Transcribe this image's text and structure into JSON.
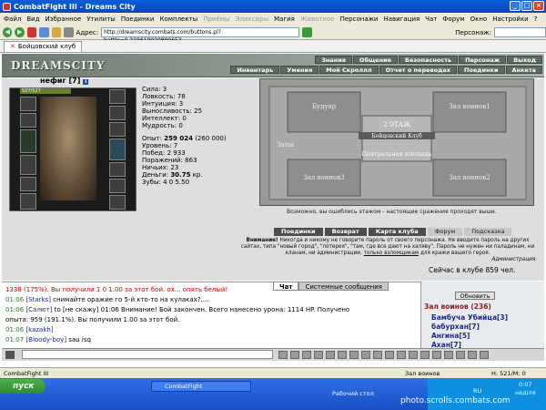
{
  "window": {
    "title": "CombatFight III - Dreams City"
  },
  "menu": [
    "Файл",
    "Вид",
    "Избранное",
    "Утилиты",
    "Поединки",
    "Комплекты",
    "Приёмы",
    "Эликсиры",
    "Магия",
    "Животное",
    "Персонажи",
    "Навигация",
    "Чат",
    "Форум",
    "Окно",
    "Настройки",
    "?"
  ],
  "menu_disabled": [
    "Приёмы",
    "Эликсиры",
    "Животное"
  ],
  "address": {
    "label": "Адрес:",
    "url": "http://dreamscity.combats.com/buttons.pl?battle=0.319619920890652",
    "person_label": "Персонаж:"
  },
  "tabs": [
    {
      "label": "Бойцовский клуб"
    }
  ],
  "banner": {
    "logo": "DREAMSCITY",
    "top": [
      "Знания",
      "Общение",
      "Безопасность",
      "Персонаж",
      "Выход"
    ],
    "bottom": [
      "Инвентарь",
      "Умения",
      "Мой Скроллл",
      "Отчет о переводах",
      "Поединки",
      "Анкета"
    ]
  },
  "character": {
    "name": "нефиг",
    "level": "[7]",
    "hp": "527/527",
    "stats": [
      {
        "label": "Сила:",
        "value": "3"
      },
      {
        "label": "Ловкость:",
        "value": "78"
      },
      {
        "label": "Интуиция:",
        "value": "3"
      },
      {
        "label": "Выносливость:",
        "value": "25"
      },
      {
        "label": "Интеллект:",
        "value": "0"
      },
      {
        "label": "Мудрость:",
        "value": "0"
      }
    ],
    "exp_label": "Опыт:",
    "exp": "259 024",
    "exp_next": "(260 000)",
    "level_label": "Уровень:",
    "level_val": "7",
    "wins_label": "Побед:",
    "wins": "2 933",
    "losses_label": "Поражений:",
    "losses": "863",
    "draws_label": "Ничьих:",
    "draws": "23",
    "money_label": "Деньги:",
    "money": "30.75",
    "money_unit": "кр.",
    "teeth_label": "Зубы:",
    "teeth": "4  0  5.50"
  },
  "map": {
    "rooms": [
      "Будуар",
      "Зал воинов1",
      "2 ЭТАЖ",
      "Бойцовский Клуб",
      "Залы",
      "Центральная площадь",
      "Зал воинов3",
      "Зал воинов2"
    ],
    "note": "Возможно, вы ошиблись этажом - настоящие сражения проходят выше."
  },
  "club_buttons": [
    {
      "label": "Поединки",
      "dark": true
    },
    {
      "label": "Возврат",
      "dark": true
    },
    {
      "label": "Карта клуба",
      "dark": true
    },
    {
      "label": "Форум",
      "dark": false
    },
    {
      "label": "Подсказка",
      "dark": false
    }
  ],
  "warning": {
    "bold": "Внимание!",
    "text": "Никогда и никому не говорите пароль от своего персонажа. Не вводите пароль на других сайтах, типа \"новый город\", \"лотерея\", \"там, где все дают на халяву\". Пароль не нужен ни паладинам, ни кланам, ни администрации,",
    "link": "только взломщикам",
    "tail": "для кражи вашего героя.",
    "sign": "Администрация."
  },
  "online": "Сейчас в клубе 859 чел.",
  "chat": {
    "tabs": [
      "Чат",
      "Системные сообщения"
    ],
    "lines": [
      {
        "time": "",
        "nick": "",
        "text": "1338 (175%). Вы получили 1 0 1.00 за этот бой. ох... опять белый!"
      },
      {
        "time": "01:06",
        "nick": "[Starks]",
        "text": "снимайте оражие го 5-й кто-то на кулаках?...."
      },
      {
        "time": "01:06",
        "nick": "[Салют]",
        "text": "to [не скажу] 01:06 Внимание! Бой закончен. Всего нанесено урона: 1114 HP. Получено"
      },
      {
        "time": "",
        "nick": "",
        "text": "опыта: 959 (191.1%). Вы получили 1.00 за этот бой."
      },
      {
        "time": "01:06",
        "nick": "[kazakh]",
        "text": ""
      },
      {
        "time": "01:07",
        "nick": "[Bloody-boy]",
        "text": "sau isq"
      }
    ]
  },
  "side": {
    "refresh": "Обновить",
    "room": "Зал воинов (236)",
    "users": [
      "Бамбуча Убийца[3]",
      "бабурхан[7]",
      "Ангина[5]",
      "Ахан[7]"
    ]
  },
  "status": {
    "left": "CombatFight III",
    "mid": "Зал воинов",
    "right": "Н: 521/М: 0"
  },
  "taskbar": {
    "start": "пуск",
    "item": "CombatFight",
    "desktop": "Рабочий стол",
    "lang": "RU",
    "time": "0:07",
    "day": "неділя"
  },
  "watermark": "photo.scrolls.combats.com"
}
